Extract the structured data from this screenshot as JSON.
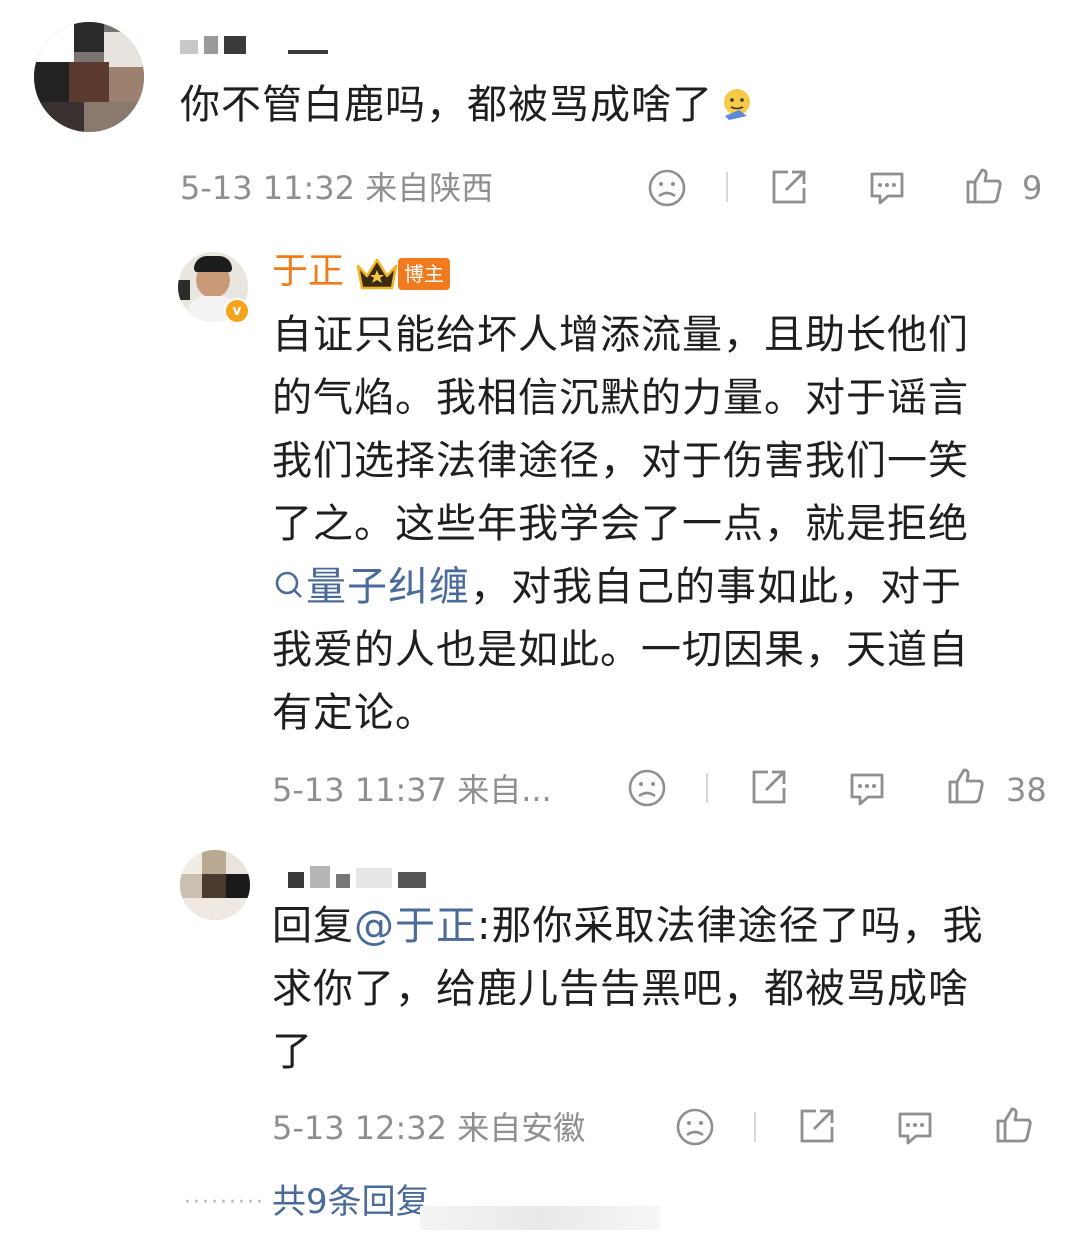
{
  "comment1": {
    "text": "你不管白鹿吗，都被骂成啥了",
    "meta": "5-13 11:32 来自陕西",
    "likes": "9",
    "emoji_icon": "face-palm-emoji-icon"
  },
  "reply1": {
    "author": "于正",
    "badge": "博主",
    "verified_mark": "v",
    "lines": [
      "自证只能给坏人增添流量，且助长他们",
      "的气焰。我相信沉默的力量。对于谣言",
      "我们选择法律途径，对于伤害我们一笑",
      "了之。这些年我学会了一点，就是拒绝"
    ],
    "line5_link": "量子纠缠",
    "line5_rest": "，对我自己的事如此，对于",
    "lines_after": [
      "我爱的人也是如此。一切因果，天道自",
      "有定论。"
    ],
    "meta": "5-13 11:37 来自...",
    "likes": "38"
  },
  "reply2": {
    "prefix": "回复",
    "mention": "@于正",
    "line1_rest": ":那你采取法律途径了吗，我",
    "lines": [
      "求你了，给鹿儿告告黑吧，都被骂成啥",
      "了"
    ],
    "meta": "5-13 12:32 来自安徽"
  },
  "more_replies": "共9条回复"
}
